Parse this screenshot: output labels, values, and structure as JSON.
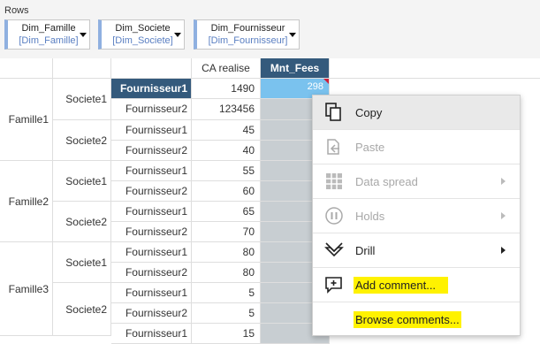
{
  "toolbar": {
    "rows_label": "Rows",
    "dims": [
      {
        "name": "Dim_Famille",
        "sub": "[Dim_Famille]"
      },
      {
        "name": "Dim_Societe",
        "sub": "[Dim_Societe]"
      },
      {
        "name": "Dim_Fournisseur",
        "sub": "[Dim_Fournisseur]"
      }
    ]
  },
  "grid": {
    "col_headers": [
      "CA realise",
      "Mnt_Fees"
    ],
    "familles": [
      "Famille1",
      "Famille2",
      "Famille3"
    ],
    "societes": [
      "Societe1",
      "Societe2",
      "Societe1",
      "Societe2",
      "Societe1",
      "Societe2"
    ],
    "fournisseurs": [
      "Fournisseur1",
      "Fournisseur2",
      "Fournisseur1",
      "Fournisseur2",
      "Fournisseur1",
      "Fournisseur2",
      "Fournisseur1",
      "Fournisseur2",
      "Fournisseur1",
      "Fournisseur2",
      "Fournisseur1",
      "Fournisseur2",
      "Fournisseur1"
    ],
    "ca_values": [
      "1490",
      "123456",
      "45",
      "40",
      "55",
      "60",
      "65",
      "70",
      "80",
      "80",
      "5",
      "5",
      "15"
    ],
    "selected_fee_value": "298"
  },
  "context_menu": {
    "items": [
      {
        "label": "Copy",
        "icon": "copy-icon",
        "enabled": true
      },
      {
        "label": "Paste",
        "icon": "paste-icon",
        "enabled": false
      },
      {
        "label": "Data spread",
        "icon": "data-spread-icon",
        "enabled": false,
        "submenu": true
      },
      {
        "label": "Holds",
        "icon": "holds-icon",
        "enabled": false,
        "submenu": true
      },
      {
        "label": "Drill",
        "icon": "drill-icon",
        "enabled": true,
        "submenu": true
      },
      {
        "label": "Add comment...",
        "icon": "add-comment-icon",
        "enabled": true,
        "highlight": "#fff200"
      },
      {
        "label": "Browse comments...",
        "icon": "",
        "enabled": true,
        "highlight": "#fff200"
      }
    ]
  },
  "colors": {
    "header_selected": "#345a7c",
    "cell_selected": "#7ac2ee",
    "fees_column": "#c8ced2",
    "chip_accent": "#8fb0e0",
    "highlight": "#fff200"
  }
}
